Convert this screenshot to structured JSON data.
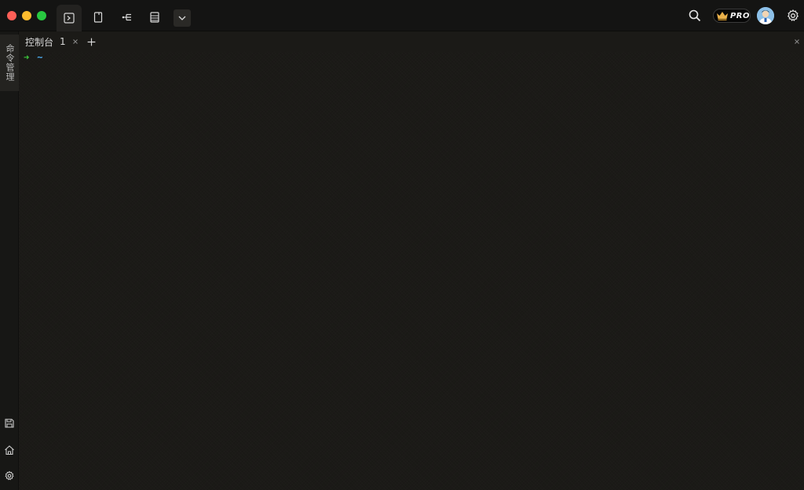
{
  "window": {
    "traffic_lights": [
      "close",
      "minimize",
      "zoom"
    ]
  },
  "toolbar": {
    "buttons": [
      {
        "name": "terminal",
        "icon": "terminal-icon",
        "active": true
      },
      {
        "name": "file",
        "icon": "file-icon",
        "active": false
      },
      {
        "name": "tree",
        "icon": "tree-icon",
        "active": false
      },
      {
        "name": "list",
        "icon": "list-icon",
        "active": false
      },
      {
        "name": "more",
        "icon": "chevron-down-icon",
        "active": false
      }
    ]
  },
  "header_right": {
    "search_icon": "search-icon",
    "pro_label": "PRO",
    "avatar_icon": "avatar",
    "settings_icon": "gear-icon"
  },
  "sidebar": {
    "tab_label": "命令管理",
    "bottom_icons": [
      "save-icon",
      "home-icon",
      "gear-icon"
    ]
  },
  "tabs": [
    {
      "label": "控制台",
      "number": "1",
      "closable": true
    }
  ],
  "terminal": {
    "prompt_symbol": "➜",
    "cwd": "~"
  },
  "colors": {
    "background": "#1b1a17",
    "titlebar": "#141413",
    "prompt_green": "#3cc93c",
    "prompt_blue": "#4aa6e8"
  }
}
